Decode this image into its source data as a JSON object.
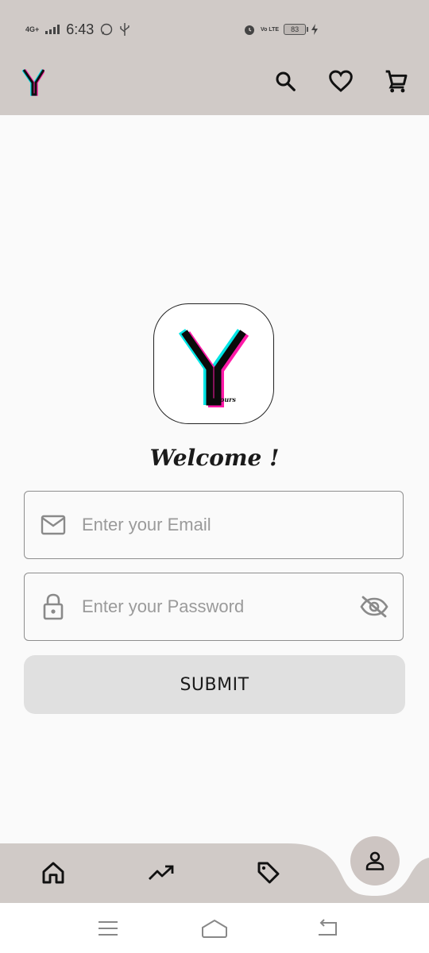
{
  "status_bar": {
    "network": "4G+",
    "time": "6:43",
    "volte": "Vo LTE",
    "battery": "83"
  },
  "header": {
    "logo": "Y",
    "icons": [
      "search-icon",
      "heart-icon",
      "cart-icon"
    ]
  },
  "brand": {
    "letter": "Y",
    "tagline": "ours"
  },
  "login": {
    "welcome": "Welcome !",
    "email_placeholder": "Enter your Email",
    "password_placeholder": "Enter your Password",
    "submit_label": "SUBMIT"
  },
  "bottom_nav": {
    "items": [
      "home-icon",
      "trending-icon",
      "tag-icon",
      "profile-icon"
    ],
    "active": "profile-icon"
  },
  "colors": {
    "bar": "#d0cac7",
    "background": "#fafafa",
    "button": "#e0e0e0",
    "logo_cyan": "#00e5e5",
    "logo_magenta": "#ff1aa8"
  }
}
